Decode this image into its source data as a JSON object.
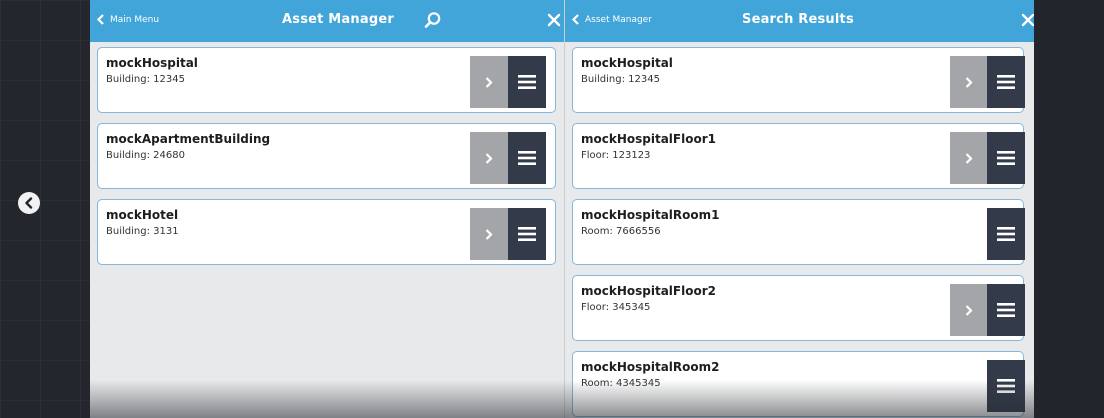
{
  "left_panel": {
    "back_label": "Main Menu",
    "title": "Asset Manager",
    "items": [
      {
        "name": "mockHospital",
        "detail": "Building: 12345",
        "has_next": true
      },
      {
        "name": "mockApartmentBuilding",
        "detail": "Building: 24680",
        "has_next": true
      },
      {
        "name": "mockHotel",
        "detail": "Building: 3131",
        "has_next": true
      }
    ]
  },
  "right_panel": {
    "back_label": "Asset Manager",
    "title": "Search Results",
    "items": [
      {
        "name": "mockHospital",
        "detail": "Building: 12345",
        "has_next": true
      },
      {
        "name": "mockHospitalFloor1",
        "detail": "Floor: 123123",
        "has_next": true
      },
      {
        "name": "mockHospitalRoom1",
        "detail": "Room: 7666556",
        "has_next": false
      },
      {
        "name": "mockHospitalFloor2",
        "detail": "Floor: 345345",
        "has_next": true
      },
      {
        "name": "mockHospitalRoom2",
        "detail": "Room: 4345345",
        "has_next": false
      }
    ]
  },
  "icons": {
    "side_back": "chevron-left-circle-icon",
    "search": "search-icon",
    "close": "close-icon",
    "next": "chevron-right-icon",
    "menu": "hamburger-icon"
  },
  "colors": {
    "header": "#41a5da",
    "card_border": "#85b7dd",
    "next_button": "#a3a5a8",
    "menu_button": "#333a4a",
    "background": "#22262c"
  }
}
